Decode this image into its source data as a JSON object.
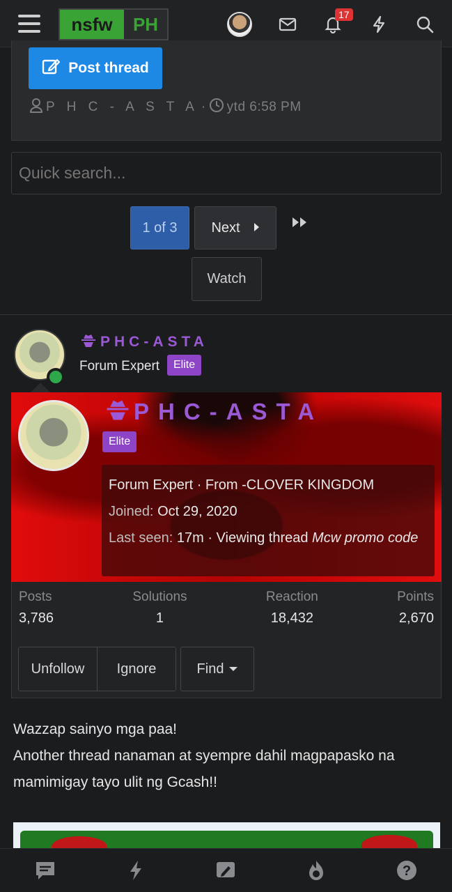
{
  "header": {
    "logo_left": "nsfw",
    "logo_right": "PH",
    "notification_count": "17"
  },
  "thread": {
    "post_thread_label": "Post thread",
    "author": "P H C - A S T A",
    "time": "ytd 6:58 PM"
  },
  "search": {
    "placeholder": "Quick search..."
  },
  "pagination": {
    "current": "1 of 3",
    "next_label": "Next"
  },
  "watch_label": "Watch",
  "post": {
    "username": "PHC-ASTA",
    "user_title": "Forum Expert",
    "badge": "Elite"
  },
  "member_card": {
    "username": "PHC-ASTA",
    "badge": "Elite",
    "title_line": "Forum Expert · From -CLOVER KINGDOM",
    "joined_label": "Joined:",
    "joined_value": "Oct 29, 2020",
    "last_seen_label": "Last seen:",
    "last_seen_value": "17m · Viewing thread",
    "viewing_thread": "Mcw promo code",
    "stats": [
      {
        "label": "Posts",
        "value": "3,786"
      },
      {
        "label": "Solutions",
        "value": "1"
      },
      {
        "label": "Reaction",
        "value": "18,432"
      },
      {
        "label": "Points",
        "value": "2,670"
      }
    ],
    "buttons": {
      "unfollow": "Unfollow",
      "ignore": "Ignore",
      "find": "Find"
    }
  },
  "body": {
    "line1": "Wazzap sainyo mga paa!",
    "line2": "Another thread nanaman at syempre dahil magpapasko na mamimigay tayo ulit ng Gcash!!"
  },
  "colors": {
    "accent_blue": "#1e88e5",
    "username_purple": "#9b59d6",
    "elite_badge": "#8e44c7",
    "online_green": "#2ea84a"
  },
  "icons": [
    "menu-icon",
    "mail-icon",
    "bell-icon",
    "bolt-icon",
    "search-icon",
    "edit-icon",
    "user-icon",
    "clock-icon",
    "chevron-right-icon",
    "double-chevron-right-icon",
    "spy-icon",
    "chat-icon",
    "pencil-icon",
    "fire-icon",
    "help-icon"
  ]
}
